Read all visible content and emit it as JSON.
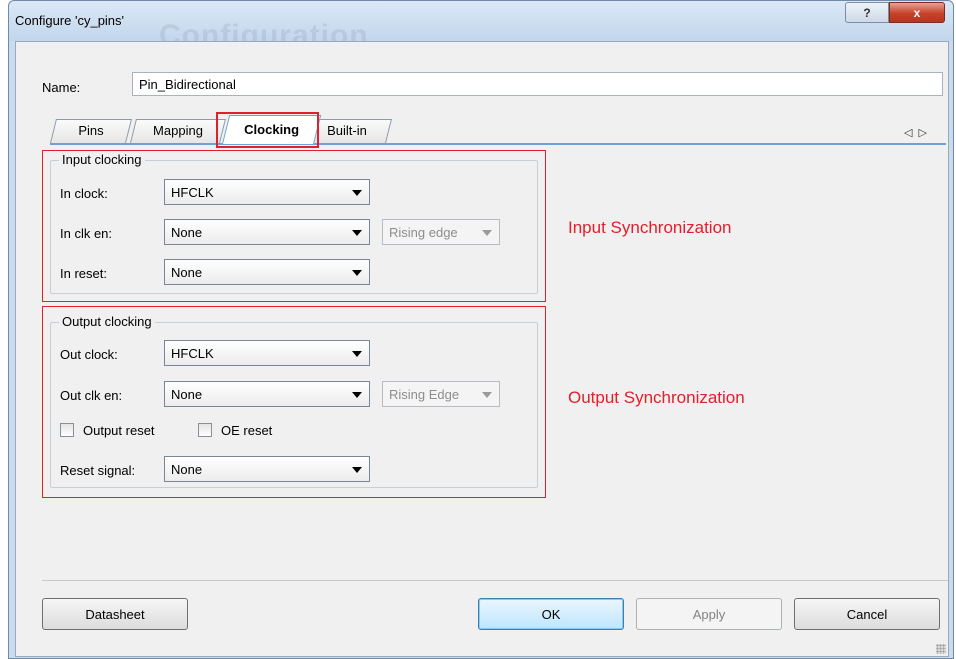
{
  "window": {
    "title": "Configure 'cy_pins'",
    "help_glyph": "?",
    "close_glyph": "x"
  },
  "name": {
    "label": "Name:",
    "value": "Pin_Bidirectional"
  },
  "tabs": [
    {
      "label": "Pins"
    },
    {
      "label": "Mapping"
    },
    {
      "label": "Clocking",
      "active": true
    },
    {
      "label": "Built-in"
    }
  ],
  "tab_nav": {
    "left": "◁",
    "right": "▷"
  },
  "input_clocking": {
    "legend": "Input clocking",
    "in_clock": {
      "label": "In clock:",
      "value": "HFCLK"
    },
    "in_clk_en": {
      "label": "In clk en:",
      "value": "None",
      "edge": "Rising edge"
    },
    "in_reset": {
      "label": "In reset:",
      "value": "None"
    }
  },
  "output_clocking": {
    "legend": "Output clocking",
    "out_clock": {
      "label": "Out clock:",
      "value": "HFCLK"
    },
    "out_clk_en": {
      "label": "Out clk en:",
      "value": "None",
      "edge": "Rising Edge"
    },
    "output_reset": {
      "label": "Output reset",
      "checked": false
    },
    "oe_reset": {
      "label": "OE reset",
      "checked": false
    },
    "reset_signal": {
      "label": "Reset signal:",
      "value": "None"
    }
  },
  "annotations": {
    "input": "Input Synchronization",
    "output": "Output Synchronization",
    "color": "#e0202c"
  },
  "buttons": {
    "datasheet": "Datasheet",
    "ok": "OK",
    "apply": "Apply",
    "cancel": "Cancel"
  }
}
